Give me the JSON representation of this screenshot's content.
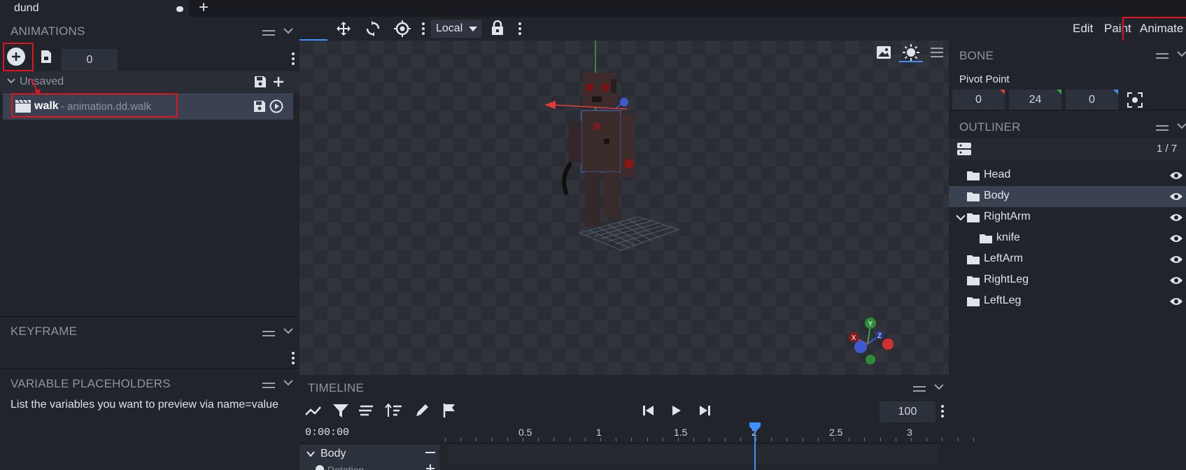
{
  "tabs": [
    {
      "label": "dund",
      "unsaved": true
    }
  ],
  "menu_modes": {
    "edit": "Edit",
    "paint": "Paint",
    "animate": "Animate"
  },
  "animations_panel": {
    "title": "ANIMATIONS",
    "counter_value": "0",
    "group_label": "Unsaved",
    "items": [
      {
        "name": "walk",
        "path": "- animation.dd.walk"
      }
    ]
  },
  "keyframe_panel": {
    "title": "KEYFRAME"
  },
  "variable_panel": {
    "title": "VARIABLE PLACEHOLDERS",
    "hint": "List the variables you want to preview via name=value"
  },
  "viewport": {
    "space_mode": "Local",
    "gizmo_axes": {
      "y": "Y",
      "x": "X",
      "z": "Z"
    }
  },
  "bone_panel": {
    "title": "BONE",
    "pivot_label": "Pivot Point",
    "pivot": [
      "0",
      "24",
      "0"
    ]
  },
  "outliner": {
    "title": "OUTLINER",
    "count": "1 / 7",
    "items": [
      {
        "name": "Head",
        "depth": 0,
        "selected": false,
        "expanded": null
      },
      {
        "name": "Body",
        "depth": 0,
        "selected": true,
        "expanded": null
      },
      {
        "name": "RightArm",
        "depth": 0,
        "selected": false,
        "expanded": true
      },
      {
        "name": "knife",
        "depth": 1,
        "selected": false,
        "expanded": null
      },
      {
        "name": "LeftArm",
        "depth": 0,
        "selected": false,
        "expanded": null
      },
      {
        "name": "RightLeg",
        "depth": 0,
        "selected": false,
        "expanded": null
      },
      {
        "name": "LeftLeg",
        "depth": 0,
        "selected": false,
        "expanded": null
      }
    ]
  },
  "timeline": {
    "title": "TIMELINE",
    "time": "0:00:00",
    "zoom": "100",
    "ruler_labels": [
      "0.5",
      "1",
      "1.5",
      "2",
      "2.5",
      "3"
    ],
    "track_label": "Body",
    "sub_track_label": "Rotation"
  },
  "colors": {
    "accent": "#3e90ff",
    "highlight": "#e0141c",
    "axis_x": "#e53935",
    "axis_y": "#43a047",
    "axis_z": "#3f51b5"
  }
}
